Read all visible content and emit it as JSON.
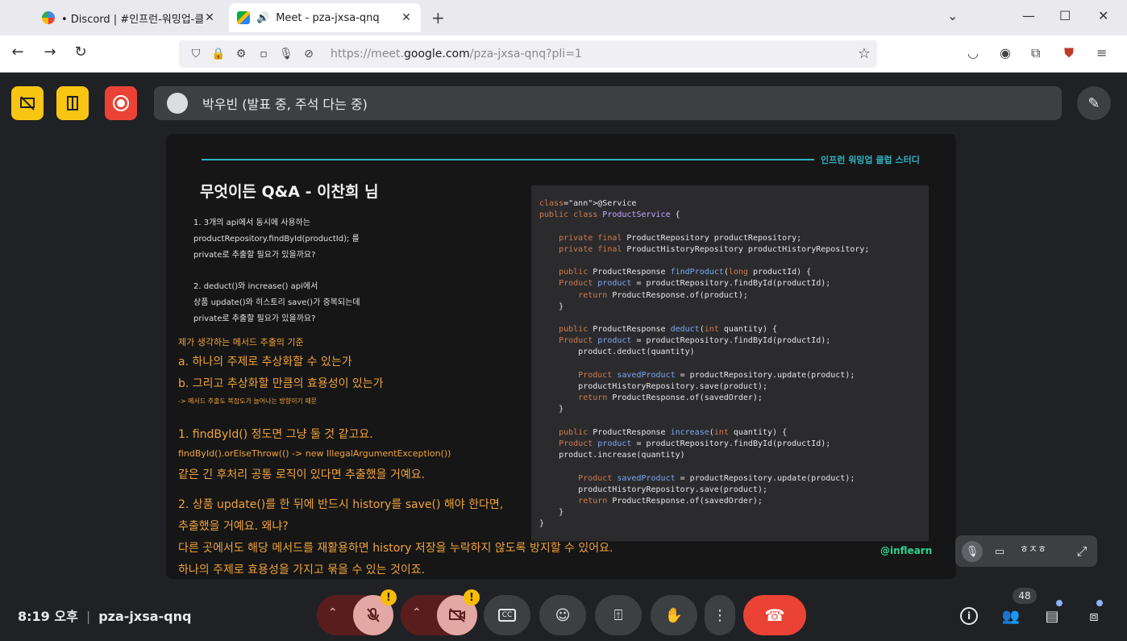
{
  "browser": {
    "tabs": [
      {
        "title": "• Discord | #인프런-워밍업-클",
        "close": "✕"
      },
      {
        "title": "Meet - pza-jxsa-qnq",
        "close": "✕"
      }
    ],
    "new_tab": "+",
    "url_prefix": "https://meet.",
    "url_domain": "google.com",
    "url_path": "/pza-jxsa-qnq?pli=1"
  },
  "meet": {
    "presenter_text": "박우빈 (발표 중, 주석 다는 중)",
    "meeting_code": "pza-jxsa-qnq",
    "time": "8:19 오후",
    "participants_count": "48",
    "selfview_label": "ㅎㅈㅎ",
    "colors": {
      "yellow": "#f9c513",
      "red": "#ea4335",
      "bg": "#202124"
    }
  },
  "slide": {
    "brand_text": "인프런 워밍업 클럽 스터디",
    "title": "무엇이든 Q&A - 이찬희 님",
    "question_lines": [
      "1. 3개의 api에서 동시에 사용하는",
      "productRepository.findById(productId); 를",
      "private로 추출할 필요가 있을까요?",
      "2. deduct()와 increase() api에서",
      "상품 update()와 히스토리 save()가 중복되는데",
      "private로 추출할 필요가 있을까요?"
    ],
    "answer_lines": [
      "제가 생각하는 메서드 추출의 기준",
      "a. 하나의 주제로 추상화할 수 있는가",
      "b. 그리고 추상화할 만큼의 효용성이 있는가",
      "-> 메서드 추출도 복잡도가 늘어나는 방향이기 때문",
      "1. findById() 정도면 그냥 둘 것 같고요.",
      "findById().orElseThrow(() -> new IllegalArgumentException())",
      "같은 긴 후처리 공통 로직이 있다면 추출했을 거예요.",
      "2. 상품 update()를 한 뒤에 반드시 history를 save() 해야 한다면,",
      "추출했을 거예요. 왜냐?",
      "다른 곳에서도 해당 메서드를 재활용하면 history 저장을 누락하지 않도록 방지할 수 있어요.",
      "하나의 주제로 효용성을 가지고 묶을 수 있는 것이죠."
    ],
    "code_lines": [
      "@Service",
      "public class ProductService {",
      "",
      "    private final ProductRepository productRepository;",
      "    private final ProductHistoryRepository productHistoryRepository;",
      "",
      "    public ProductResponse findProduct(long productId) {",
      "    Product product = productRepository.findById(productId);",
      "        return ProductResponse.of(product);",
      "    }",
      "",
      "    public ProductResponse deduct(int quantity) {",
      "    Product product = productRepository.findById(productId);",
      "        product.deduct(quantity)",
      "",
      "        Product savedProduct = productRepository.update(product);",
      "        productHistoryRepository.save(product);",
      "        return ProductResponse.of(savedOrder);",
      "    }",
      "",
      "    public ProductResponse increase(int quantity) {",
      "    Product product = productRepository.findById(productId);",
      "    product.increase(quantity)",
      "",
      "        Product savedProduct = productRepository.update(product);",
      "        productHistoryRepository.save(product);",
      "        return ProductResponse.of(savedOrder);",
      "    }",
      "}"
    ],
    "logo": "@inflearn"
  },
  "icons": {
    "tab1": "discord-favicon-icon",
    "tab2": "meet-favicon-icon",
    "audio": "speaker-icon",
    "back": "back-arrow-icon",
    "forward": "forward-arrow-icon",
    "reload": "reload-icon",
    "shield": "shield-icon",
    "lock": "lock-icon",
    "star": "bookmark-star-icon"
  }
}
